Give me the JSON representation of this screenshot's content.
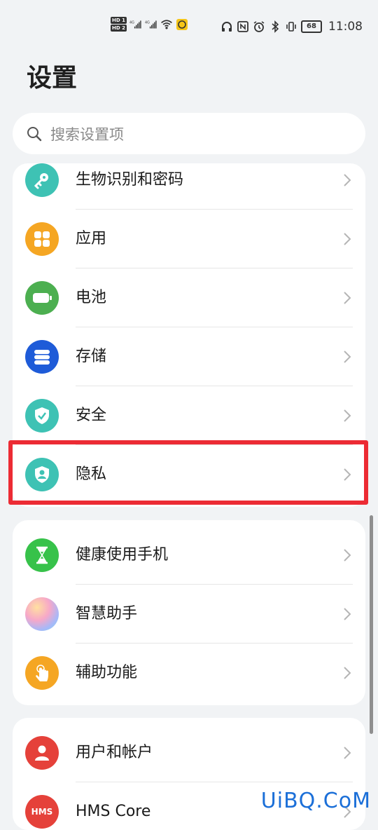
{
  "status_bar": {
    "hd1": "HD 1",
    "hd2": "HD 2",
    "sig1": "4G",
    "sig2": "4G",
    "battery": "68",
    "time": "11:08"
  },
  "header": {
    "title": "设置"
  },
  "search": {
    "placeholder": "搜索设置项"
  },
  "group1": {
    "items": [
      {
        "label": "生物识别和密码",
        "icon": "key-icon",
        "color": "#3ec2b4"
      },
      {
        "label": "应用",
        "icon": "apps-grid-icon",
        "color": "#f5a623"
      },
      {
        "label": "电池",
        "icon": "battery-icon",
        "color": "#4caf50"
      },
      {
        "label": "存储",
        "icon": "storage-icon",
        "color": "#1e5bd8"
      },
      {
        "label": "安全",
        "icon": "shield-check-icon",
        "color": "#3ec2b4"
      },
      {
        "label": "隐私",
        "icon": "privacy-shield-icon",
        "color": "#3ec2b4"
      }
    ]
  },
  "group2": {
    "items": [
      {
        "label": "健康使用手机",
        "icon": "hourglass-icon",
        "color": "#37c24a"
      },
      {
        "label": "智慧助手",
        "icon": "assistant-orb-icon",
        "color": "#c9a7ef"
      },
      {
        "label": "辅助功能",
        "icon": "hand-touch-icon",
        "color": "#f5a623"
      }
    ]
  },
  "group3": {
    "items": [
      {
        "label": "用户和帐户",
        "icon": "user-icon",
        "color": "#e5413a"
      },
      {
        "label": "HMS Core",
        "icon": "hms-icon",
        "color": "#e5413a",
        "icon_text": "HMS"
      }
    ]
  },
  "watermark": "UiBQ.CoM"
}
